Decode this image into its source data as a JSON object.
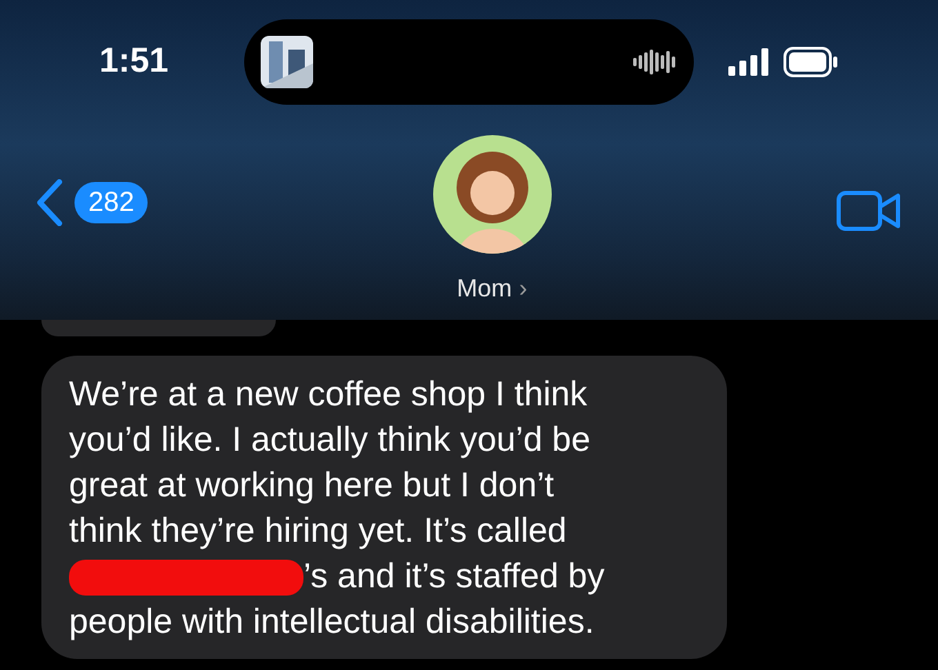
{
  "status_bar": {
    "time": "1:51"
  },
  "nav": {
    "back_count": "282",
    "contact_name": "Mom",
    "chevron": "›"
  },
  "messages": [
    {
      "kind": "partial"
    },
    {
      "kind": "text",
      "lines": [
        {
          "text": "We’re at a new coffee shop I think",
          "redacted": false
        },
        {
          "text": "you’d like. I actually think you’d be",
          "redacted": false
        },
        {
          "text": "great at working here but I don’t",
          "redacted": false
        },
        {
          "text": "think they’re hiring yet. It’s called",
          "redacted": false
        },
        {
          "text": "’s and it’s staffed by",
          "redacted": true
        },
        {
          "text": "people with intellectual disabilities.",
          "redacted": false
        }
      ]
    }
  ]
}
